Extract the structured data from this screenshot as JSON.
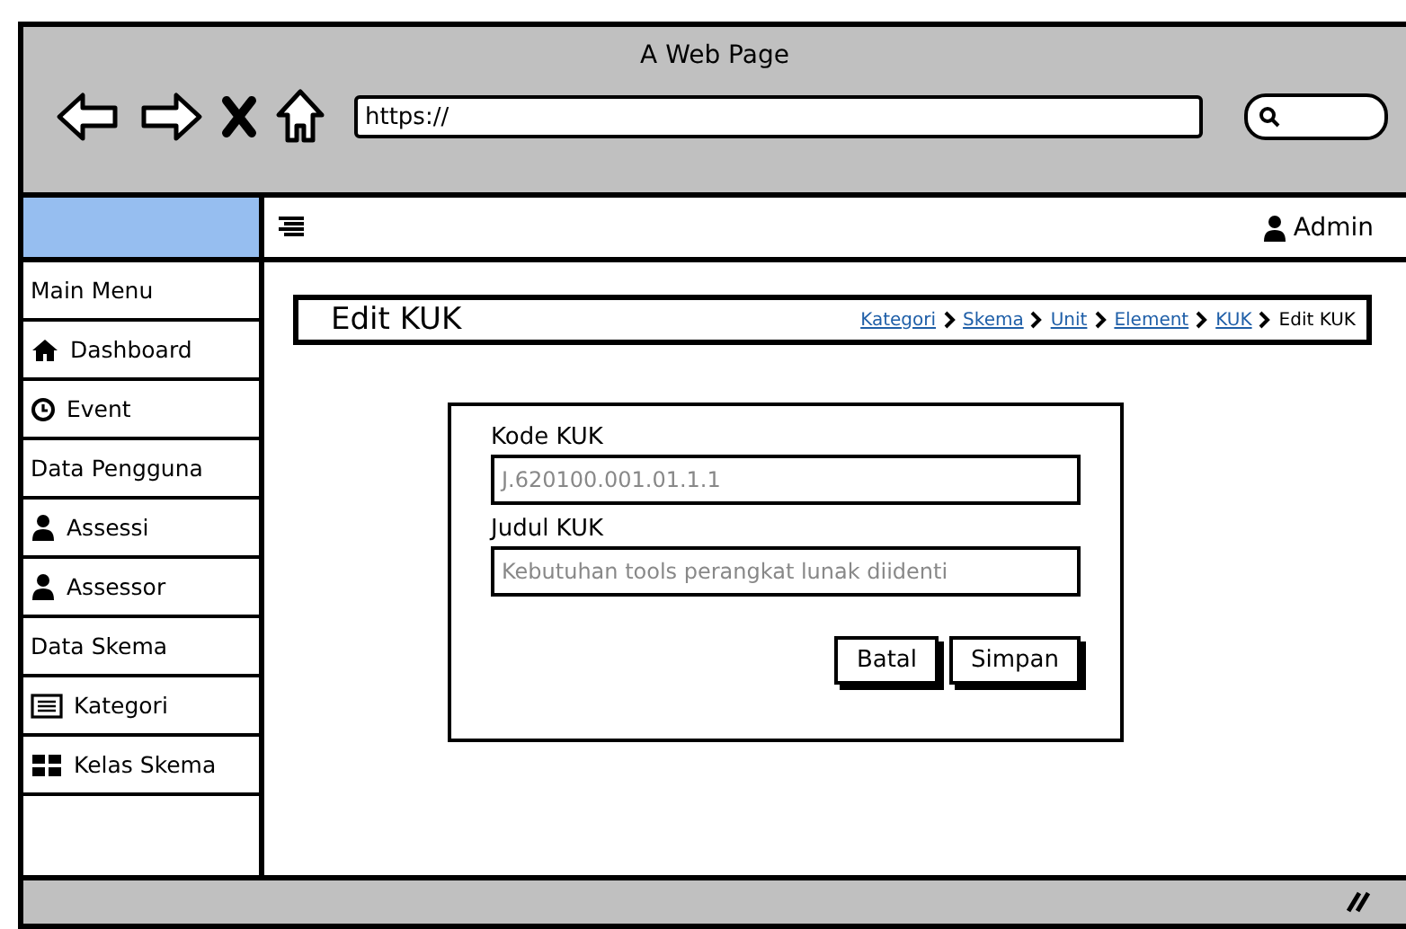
{
  "browser": {
    "title": "A Web Page",
    "url": "https://"
  },
  "topbar": {
    "user": "Admin"
  },
  "sidebar": {
    "items": [
      {
        "label": "Main Menu",
        "kind": "header"
      },
      {
        "label": "Dashboard",
        "kind": "home"
      },
      {
        "label": "Event",
        "kind": "clock"
      },
      {
        "label": "Data Pengguna",
        "kind": "header"
      },
      {
        "label": "Assessi",
        "kind": "user"
      },
      {
        "label": "Assessor",
        "kind": "user"
      },
      {
        "label": "Data Skema",
        "kind": "header"
      },
      {
        "label": "Kategori",
        "kind": "list"
      },
      {
        "label": "Kelas Skema",
        "kind": "grid"
      }
    ]
  },
  "page": {
    "title": "Edit KUK",
    "breadcrumbs": [
      {
        "label": "Kategori",
        "current": false
      },
      {
        "label": "Skema",
        "current": false
      },
      {
        "label": "Unit",
        "current": false
      },
      {
        "label": "Element",
        "current": false
      },
      {
        "label": "KUK",
        "current": false
      },
      {
        "label": "Edit KUK",
        "current": true
      }
    ]
  },
  "form": {
    "fields": [
      {
        "label": "Kode KUK",
        "value": "J.620100.001.01.1.1"
      },
      {
        "label": "Judul KUK",
        "value": "Kebutuhan tools perangkat lunak diidenti"
      }
    ],
    "buttons": [
      "Batal",
      "Simpan"
    ]
  }
}
